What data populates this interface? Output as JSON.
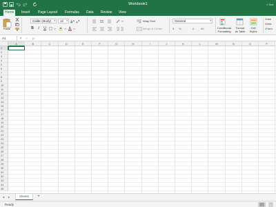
{
  "app": {
    "title": "Workbook1",
    "search_hint": "Sea"
  },
  "tabs": [
    {
      "label": "Home",
      "active": true
    },
    {
      "label": "Insert"
    },
    {
      "label": "Page Layout"
    },
    {
      "label": "Formulas"
    },
    {
      "label": "Data"
    },
    {
      "label": "Review"
    },
    {
      "label": "View"
    }
  ],
  "ribbon": {
    "paste_label": "Paste",
    "font_name": "Calibri (Body)",
    "font_size": "12",
    "bold": "B",
    "italic": "I",
    "underline": "U",
    "wrap_text": "Wrap Text",
    "merge_center": "Merge & Center",
    "number_format": "General",
    "conditional_formatting": [
      "Conditional",
      "Formatting"
    ],
    "format_as_table": [
      "Format",
      "as Table"
    ],
    "cell_styles": [
      "Cell",
      "Styles"
    ],
    "right_items": [
      "Inse",
      "Dele",
      "Form"
    ]
  },
  "formula_bar": {
    "name_box": "A1",
    "fx": "fx",
    "value": ""
  },
  "grid": {
    "columns": [
      "A",
      "B",
      "C",
      "D",
      "E",
      "F",
      "G",
      "H",
      "I",
      "J",
      "K",
      "L",
      "M",
      "N",
      "O",
      "P"
    ],
    "selected_column": "A",
    "rows": [
      "1",
      "2",
      "3",
      "4",
      "5",
      "6",
      "7",
      "8",
      "9",
      "10",
      "11",
      "12",
      "13",
      "14",
      "15",
      "16",
      "17",
      "18",
      "19",
      "20",
      "21",
      "22",
      "23",
      "24",
      "25",
      "26",
      "27",
      "28",
      "29",
      "30",
      "31",
      "32",
      "33",
      "34",
      "35"
    ],
    "selected_row": "1",
    "active_cell": "A1"
  },
  "sheets": {
    "tabs": [
      "Sheet1"
    ],
    "add": "+"
  },
  "status": {
    "text": "Ready"
  },
  "colors": {
    "brand": "#217346",
    "ribbon_bg": "#f3f3f3",
    "grid_line": "#e6e6e6"
  }
}
